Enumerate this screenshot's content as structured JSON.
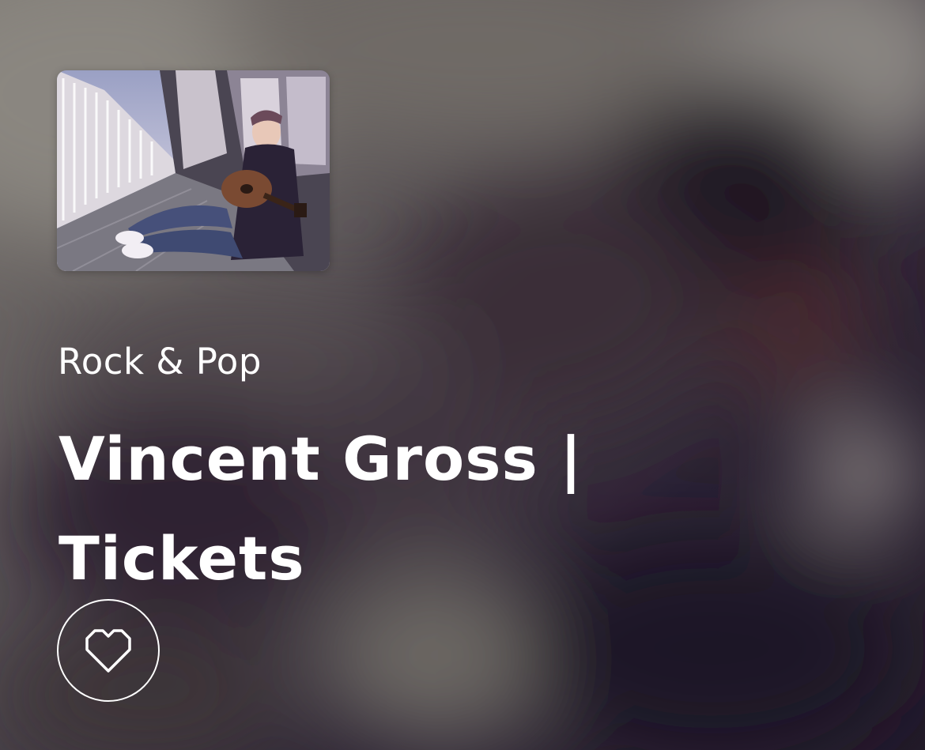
{
  "event": {
    "category": "Rock & Pop",
    "title": "Vincent Gross | Tickets"
  },
  "artwork": {
    "image_icon": "artist-photo"
  },
  "favorite": {
    "icon": "heart-outline-icon"
  },
  "colors": {
    "text": "#ffffff",
    "background_dark": "#2a2230",
    "background_light": "#6e6a66"
  }
}
